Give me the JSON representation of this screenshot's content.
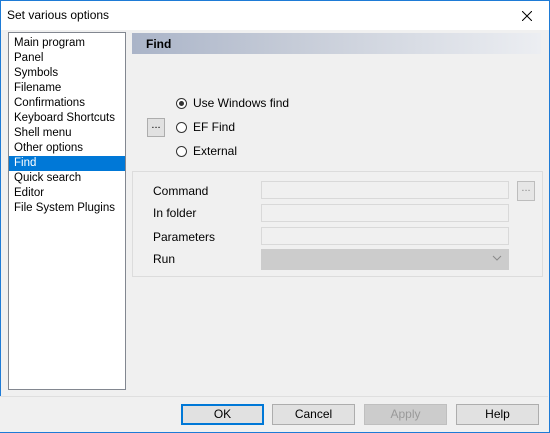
{
  "window": {
    "title": "Set various options",
    "close_label": "✕"
  },
  "sidebar": {
    "items": [
      {
        "label": "Main program"
      },
      {
        "label": "Panel"
      },
      {
        "label": "Symbols"
      },
      {
        "label": "Filename"
      },
      {
        "label": "Confirmations"
      },
      {
        "label": "Keyboard Shortcuts"
      },
      {
        "label": "Shell menu"
      },
      {
        "label": "Other options"
      },
      {
        "label": "Find",
        "selected": true
      },
      {
        "label": "Quick search"
      },
      {
        "label": "Editor"
      },
      {
        "label": "File System Plugins"
      }
    ]
  },
  "page": {
    "header": "Find",
    "browse_label": "...",
    "radios": [
      {
        "label": "Use Windows find",
        "checked": true
      },
      {
        "label": "EF Find",
        "checked": false
      },
      {
        "label": "External",
        "checked": false
      }
    ],
    "fields": {
      "command_label": "Command",
      "command_value": "",
      "command_browse": "...",
      "folder_label": "In folder",
      "folder_value": "",
      "parameters_label": "Parameters",
      "parameters_value": "",
      "run_label": "Run",
      "run_value": ""
    }
  },
  "buttons": {
    "ok": "OK",
    "cancel": "Cancel",
    "apply": "Apply",
    "help": "Help"
  },
  "colors": {
    "accent": "#0078d7",
    "window_border": "#1e7bd6"
  }
}
